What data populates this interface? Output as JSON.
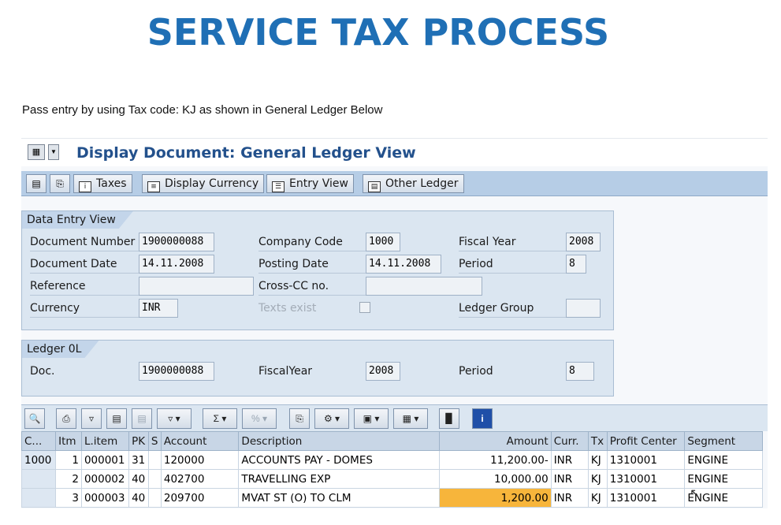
{
  "slide": {
    "title": "SERVICE TAX PROCESS",
    "subtitle": "Pass entry by using Tax code: KJ as shown in General Ledger Below"
  },
  "window": {
    "title": "Display Document: General Ledger View"
  },
  "toolbar": {
    "taxes_label": "Taxes",
    "display_currency_label": "Display Currency",
    "entry_view_label": "Entry View",
    "other_ledger_label": "Other Ledger"
  },
  "data_entry": {
    "group_title": "Data Entry View",
    "document_number_label": "Document Number",
    "document_number": "1900000088",
    "company_code_label": "Company Code",
    "company_code": "1000",
    "fiscal_year_label": "Fiscal Year",
    "fiscal_year": "2008",
    "document_date_label": "Document Date",
    "document_date": "14.11.2008",
    "posting_date_label": "Posting Date",
    "posting_date": "14.11.2008",
    "period_label": "Period",
    "period": "8",
    "reference_label": "Reference",
    "reference": "",
    "cross_cc_label": "Cross-CC no.",
    "cross_cc": "",
    "currency_label": "Currency",
    "currency": "INR",
    "texts_exist_label": "Texts exist",
    "ledger_group_label": "Ledger Group",
    "ledger_group": ""
  },
  "ledger": {
    "group_title": "Ledger 0L",
    "doc_label": "Doc.",
    "doc": "1900000088",
    "fiscal_year_label": "FiscalYear",
    "fiscal_year": "2008",
    "period_label": "Period",
    "period": "8"
  },
  "grid": {
    "columns": [
      "C...",
      "Itm",
      "L.item",
      "PK",
      "S",
      "Account",
      "Description",
      "Amount",
      "Curr.",
      "Tx",
      "Profit Center",
      "Segment"
    ],
    "rows": [
      {
        "c": "1000",
        "itm": "1",
        "litem": "000001",
        "pk": "31",
        "s": "",
        "account": "120000",
        "description": "ACCOUNTS PAY - DOMES",
        "amount": "11,200.00-",
        "curr": "INR",
        "tx": "KJ",
        "profit_center": "1310001",
        "segment": "ENGINE"
      },
      {
        "c": "",
        "itm": "2",
        "litem": "000002",
        "pk": "40",
        "s": "",
        "account": "402700",
        "description": "TRAVELLING EXP",
        "amount": "10,000.00",
        "curr": "INR",
        "tx": "KJ",
        "profit_center": "1310001",
        "segment": "ENGINE"
      },
      {
        "c": "",
        "itm": "3",
        "litem": "000003",
        "pk": "40",
        "s": "",
        "account": "209700",
        "description": "MVAT ST (O) TO CLM",
        "amount": "1,200.00",
        "curr": "INR",
        "tx": "KJ",
        "profit_center": "1310001",
        "segment": "ENGINE"
      }
    ]
  },
  "colors": {
    "title_blue": "#1f6fb5",
    "highlight": "#f7b53b"
  },
  "icons": {
    "toolbar": [
      "document-overview-icon",
      "print-icon",
      "taxes-info-icon",
      "display-currency-icon",
      "entry-view-icon",
      "other-ledger-icon"
    ],
    "grid": [
      "details-icon",
      "print-icon",
      "filter-icon",
      "find-icon",
      "find-next-icon",
      "set-filter-icon",
      "sum-icon",
      "subtotal-icon",
      "print-preview-icon",
      "change-layout-icon",
      "export-icon",
      "select-layout-icon",
      "choose-columns-icon",
      "info-icon"
    ]
  }
}
